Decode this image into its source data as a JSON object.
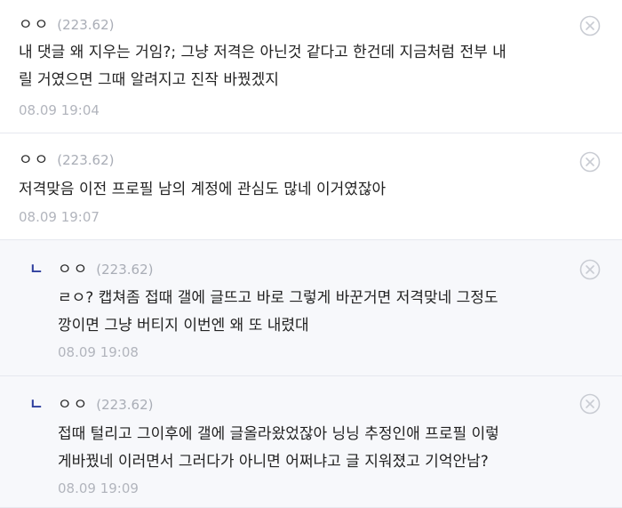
{
  "comments": [
    {
      "author": "ㅇㅇ",
      "ip": "(223.62)",
      "text": "내 댓글 왜 지우는 거임?; 그냥 저격은 아닌것 같다고 한건데 지금처럼 전부 내\n릴 거였으면 그때 알려지고 진작 바꿨겠지",
      "time": "08.09 19:04",
      "is_reply": false
    },
    {
      "author": "ㅇㅇ",
      "ip": "(223.62)",
      "text": "저격맞음 이전 프로필 남의 계정에 관심도 많네 이거였잖아",
      "time": "08.09 19:07",
      "is_reply": false
    },
    {
      "reply_marker": "ㄴ",
      "author": "ㅇㅇ",
      "ip": "(223.62)",
      "text": "ㄹㅇ? 캡쳐좀 접때 갤에 글뜨고 바로 그렇게 바꾼거면 저격맞네 그정도\n깡이면 그냥 버티지 이번엔 왜 또 내렸대",
      "time": "08.09 19:08",
      "is_reply": true
    },
    {
      "reply_marker": "ㄴ",
      "author": "ㅇㅇ",
      "ip": "(223.62)",
      "text": "접때 털리고 그이후에 갤에 글올라왔었잖아 닝닝 추정인애 프로필 이렇\n게바꿨네 이러면서 그러다가 아니면 어쩌냐고 글 지워졌고 기억안남?",
      "time": "08.09 19:09",
      "is_reply": true
    }
  ],
  "icons": {
    "delete": "close-circle-icon"
  },
  "colors": {
    "reply_marker": "#2f3f9e",
    "meta_gray": "#a9adb6",
    "reply_background": "#f7f8fb",
    "divider": "#e6e8ef"
  }
}
